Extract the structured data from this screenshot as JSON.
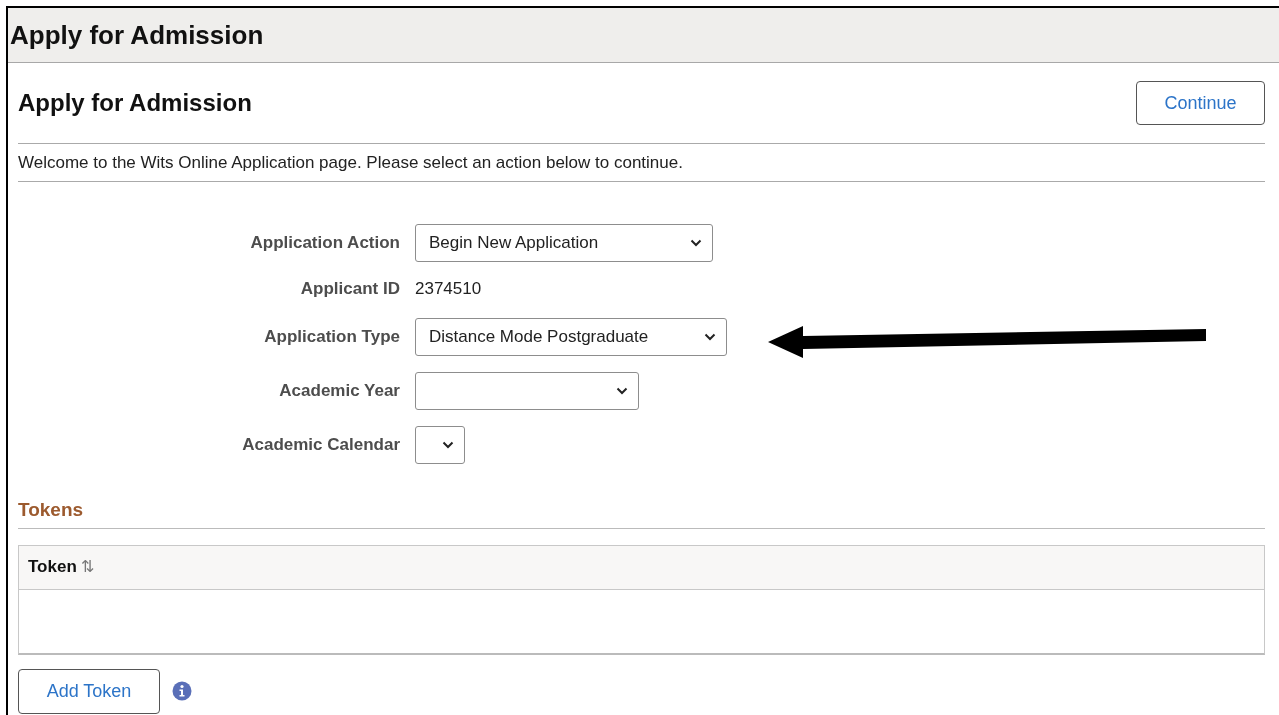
{
  "header": {
    "title": "Apply for Admission"
  },
  "page": {
    "title": "Apply for Admission",
    "continue_button": "Continue",
    "intro": "Welcome to the Wits Online Application page. Please select an action below to continue."
  },
  "fields": [
    {
      "label": "Application Action",
      "kind": "select",
      "value": "Begin New Application"
    },
    {
      "label": "Applicant ID",
      "kind": "display",
      "value": "2374510"
    },
    {
      "label": "Application Type",
      "kind": "select",
      "value": "Distance Mode Postgraduate"
    },
    {
      "label": "Academic Year",
      "kind": "select"
    },
    {
      "label": "Academic Calendar",
      "kind": "select"
    }
  ],
  "tokens": {
    "title": "Tokens",
    "columns": [
      {
        "label": "Token",
        "sort_icon": "⇅"
      }
    ],
    "add_button": "Add Token"
  }
}
